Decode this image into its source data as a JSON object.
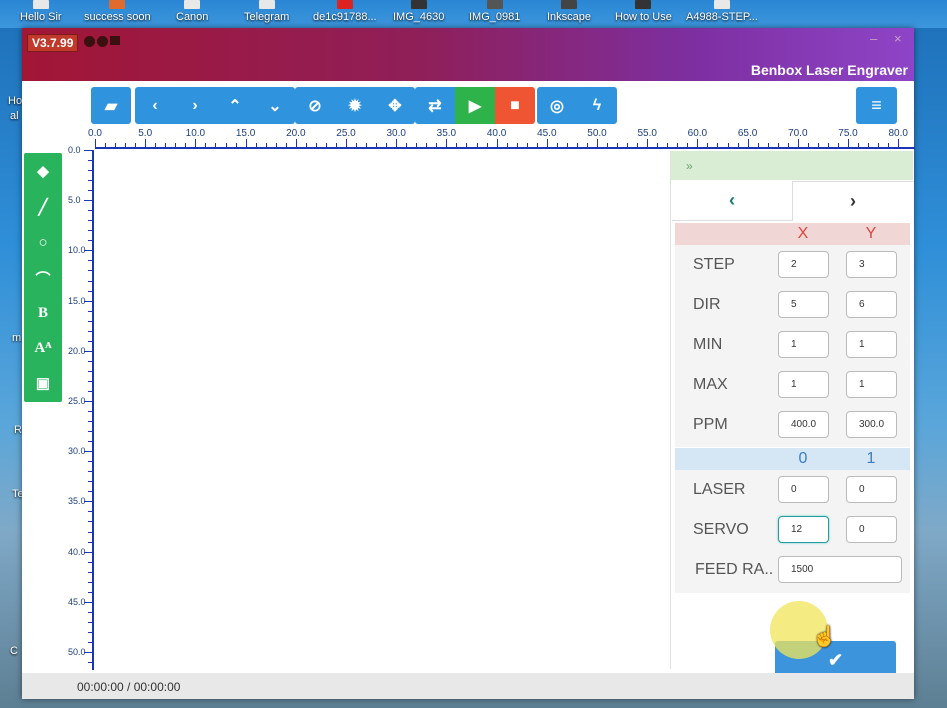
{
  "desktop": {
    "icons": [
      "Hello Sir",
      "success soon",
      "Canon",
      "Telegram",
      "de1c91788...",
      "IMG_4630",
      "IMG_0981",
      "Inkscape",
      "How to Use",
      "A4988-STEP..."
    ],
    "side_labels": [
      "Ho",
      "al",
      "m",
      "R",
      "Te",
      "C"
    ]
  },
  "window": {
    "version": "V3.7.99",
    "app_title": "Benbox Laser Engraver",
    "controls": [
      "–",
      "×"
    ]
  },
  "toolbar": {
    "group1": [
      "folder-open-icon"
    ],
    "group2": [
      "chevron-left-icon",
      "chevron-right-icon",
      "chevron-up-icon",
      "chevron-down-icon"
    ],
    "group3": [
      "ban-icon",
      "sun-icon",
      "move-icon"
    ],
    "group4": [
      "repeat-icon",
      "play-icon",
      "stop-icon"
    ],
    "group5": [
      "target-icon",
      "bolt-icon"
    ],
    "menu": "menu-icon"
  },
  "ruler": {
    "x_labels": [
      "0.0",
      "5.0",
      "10.0",
      "15.0",
      "20.0",
      "25.0",
      "30.0",
      "35.0",
      "40.0",
      "45.0",
      "50.0",
      "55.0",
      "60.0",
      "65.0",
      "70.0",
      "75.0",
      "80.0"
    ],
    "y_labels": [
      "0.0",
      "5.0",
      "10.0",
      "15.0",
      "20.0",
      "25.0",
      "30.0",
      "35.0",
      "40.0",
      "45.0",
      "50.0"
    ]
  },
  "tools": [
    "tag-icon",
    "line-icon",
    "circle-icon",
    "arc-icon",
    "bold-text-icon",
    "font-size-icon",
    "image-icon"
  ],
  "panel": {
    "collapse": "»",
    "prev": "‹",
    "next": "›",
    "axis_header": {
      "x": "X",
      "y": "Y"
    },
    "rows": [
      {
        "label": "STEP",
        "x": "2",
        "y": "3"
      },
      {
        "label": "DIR",
        "x": "5",
        "y": "6"
      },
      {
        "label": "MIN",
        "x": "1",
        "y": "1"
      },
      {
        "label": "MAX",
        "x": "1",
        "y": "1"
      },
      {
        "label": "PPM",
        "x": "400.0",
        "y": "300.0"
      }
    ],
    "io_header": {
      "c0": "0",
      "c1": "1"
    },
    "io_rows": [
      {
        "label": "LASER",
        "v0": "0",
        "v1": "0"
      },
      {
        "label": "SERVO",
        "v0": "12",
        "v1": "0"
      }
    ],
    "feed": {
      "label": "FEED RA..",
      "value": "1500"
    },
    "confirm": "✔"
  },
  "status": {
    "time": "00:00:00 / 00:00:00"
  }
}
